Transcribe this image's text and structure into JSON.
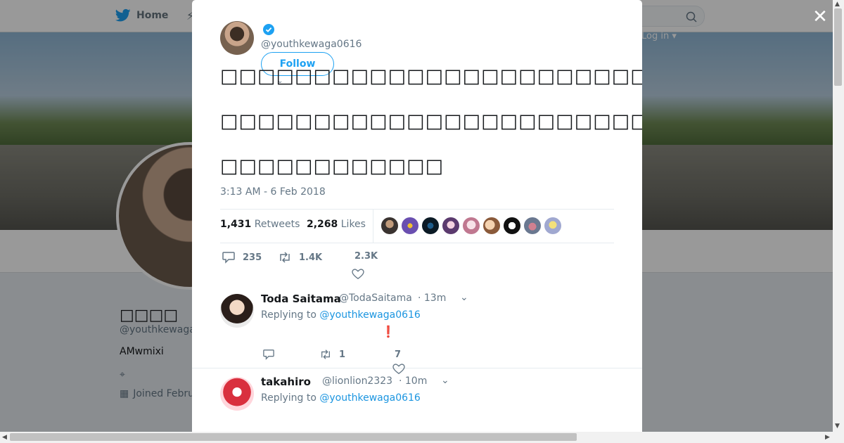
{
  "nav": {
    "home_label": "Home",
    "login_label": "Log in"
  },
  "profile": {
    "name": "□□□□",
    "handle": "@youthkewaga",
    "bio": "AMwmixi",
    "joined": "Joined Febru"
  },
  "tweet": {
    "handle": "@youthkewaga0616",
    "follow_label": "Follow",
    "text_lines": [
      "□□□□□□□□□□□□□□□□□□□□□□□□□□□□□□□□□□□□□□□□□□□□□□□□□□",
      "□□□□□□□□□□□□□□□□□□□□□□□□□□□□□□□",
      "□□□□□□□□□□□□"
    ],
    "timestamp": "3:13 AM - 6 Feb 2018",
    "retweets_count": "1,431",
    "retweets_label": "Retweets",
    "likes_count": "2,268",
    "likes_label": "Likes",
    "actions": {
      "replies": "235",
      "retweets": "1.4K",
      "likes": "2.3K"
    }
  },
  "replies": [
    {
      "name": "Toda Saitama",
      "handle": "@TodaSaitama",
      "time": "· 13m",
      "replying_prefix": "Replying to",
      "replying_to": "@youthkewaga0616",
      "text": "❗",
      "retweets": "1",
      "likes": "7"
    },
    {
      "name": "takahiro",
      "handle": "@lionlion2323",
      "time": "· 10m",
      "replying_prefix": "Replying to",
      "replying_to": "@youthkewaga0616"
    }
  ],
  "colors": {
    "accent": "#1da1f2",
    "link": "#1b95e0",
    "muted": "#657786"
  }
}
